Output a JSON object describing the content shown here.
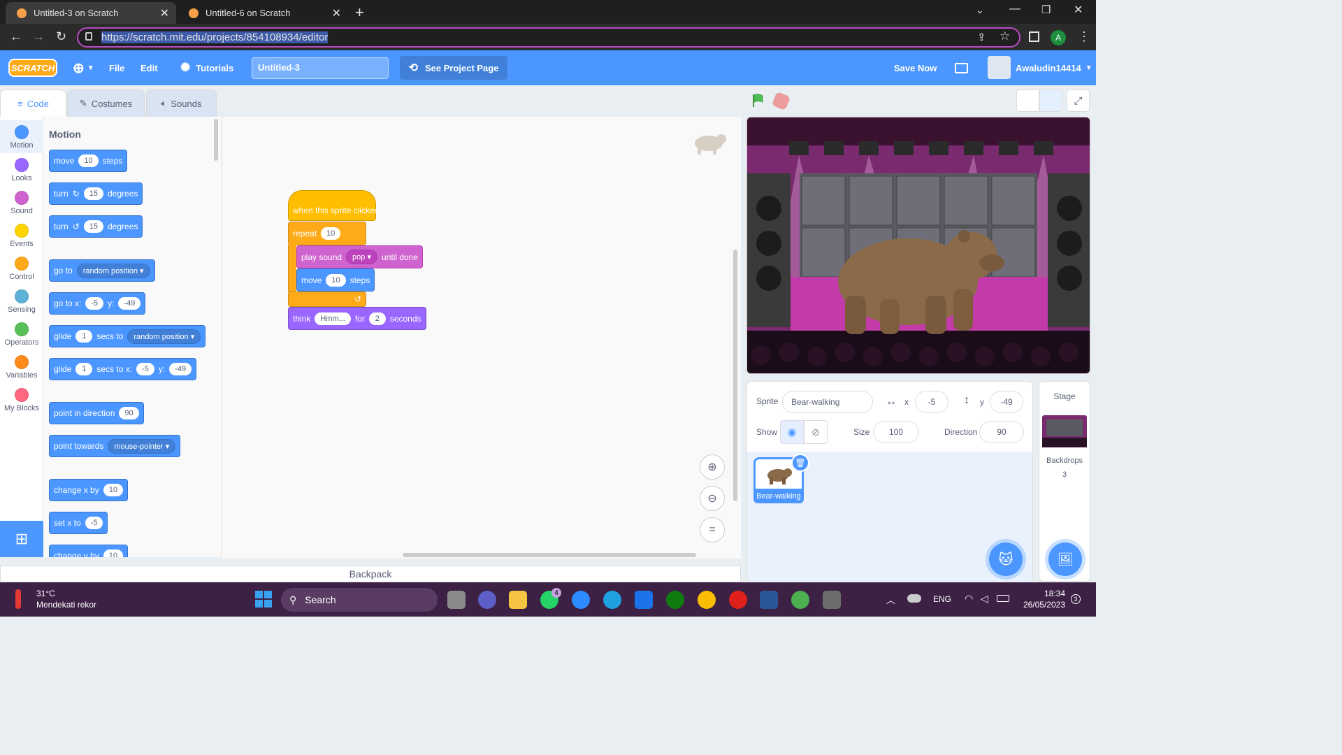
{
  "browser": {
    "tabs": [
      {
        "title": "Untitled-3 on Scratch"
      },
      {
        "title": "Untitled-6 on Scratch"
      }
    ],
    "url": "https://scratch.mit.edu/projects/854108934/editor",
    "profile_initial": "A"
  },
  "menu": {
    "logo": "SCRATCH",
    "file": "File",
    "edit": "Edit",
    "tutorials": "Tutorials",
    "project_title": "Untitled-3",
    "see_project": "See Project Page",
    "save_now": "Save Now",
    "username": "Awaludin14414"
  },
  "editor_tabs": {
    "code": "Code",
    "costumes": "Costumes",
    "sounds": "Sounds"
  },
  "categories": [
    {
      "label": "Motion",
      "color": "#4c97ff"
    },
    {
      "label": "Looks",
      "color": "#9966ff"
    },
    {
      "label": "Sound",
      "color": "#cf63cf"
    },
    {
      "label": "Events",
      "color": "#ffd500"
    },
    {
      "label": "Control",
      "color": "#ffab19"
    },
    {
      "label": "Sensing",
      "color": "#5cb1d6"
    },
    {
      "label": "Operators",
      "color": "#59c059"
    },
    {
      "label": "Variables",
      "color": "#ff8c1a"
    },
    {
      "label": "My Blocks",
      "color": "#ff6680"
    }
  ],
  "palette": {
    "heading": "Motion",
    "move": {
      "a": "move",
      "v": "10",
      "b": "steps"
    },
    "turn_cw": {
      "a": "turn",
      "v": "15",
      "b": "degrees"
    },
    "turn_ccw": {
      "a": "turn",
      "v": "15",
      "b": "degrees"
    },
    "goto": {
      "a": "go to",
      "dd": "random position"
    },
    "gotoxy": {
      "a": "go to x:",
      "x": "-5",
      "b": "y:",
      "y": "-49"
    },
    "glide1": {
      "a": "glide",
      "v": "1",
      "b": "secs to",
      "dd": "random position"
    },
    "glide2": {
      "a": "glide",
      "v": "1",
      "b": "secs to x:",
      "x": "-5",
      "c": "y:",
      "y": "-49"
    },
    "point_dir": {
      "a": "point in direction",
      "v": "90"
    },
    "point_towards": {
      "a": "point towards",
      "dd": "mouse-pointer"
    },
    "change_x": {
      "a": "change x by",
      "v": "10"
    },
    "set_x": {
      "a": "set x to",
      "v": "-5"
    },
    "change_y": {
      "a": "change y by",
      "v": "10"
    }
  },
  "script": {
    "hat": "when this sprite clicked",
    "repeat": {
      "a": "repeat",
      "v": "10"
    },
    "play": {
      "a": "play sound",
      "dd": "pop",
      "b": "until done"
    },
    "move": {
      "a": "move",
      "v": "10",
      "b": "steps"
    },
    "think": {
      "a": "think",
      "msg": "Hmm...",
      "b": "for",
      "v": "2",
      "c": "seconds"
    }
  },
  "backpack": "Backpack",
  "sprite_info": {
    "sprite_label": "Sprite",
    "sprite_name": "Bear-walking",
    "x_label": "x",
    "x": "-5",
    "y_label": "y",
    "y": "-49",
    "show_label": "Show",
    "size_label": "Size",
    "size": "100",
    "direction_label": "Direction",
    "direction": "90",
    "thumb_name": "Bear-walking"
  },
  "stage_panel": {
    "title": "Stage",
    "backdrops_label": "Backdrops",
    "backdrops_count": "3"
  },
  "taskbar": {
    "temp": "31°C",
    "weather": "Mendekati rekor",
    "search": "Search",
    "lang": "ENG",
    "time": "18:34",
    "date": "26/05/2023",
    "whatsapp_badge": "4",
    "notif_count": "3"
  }
}
